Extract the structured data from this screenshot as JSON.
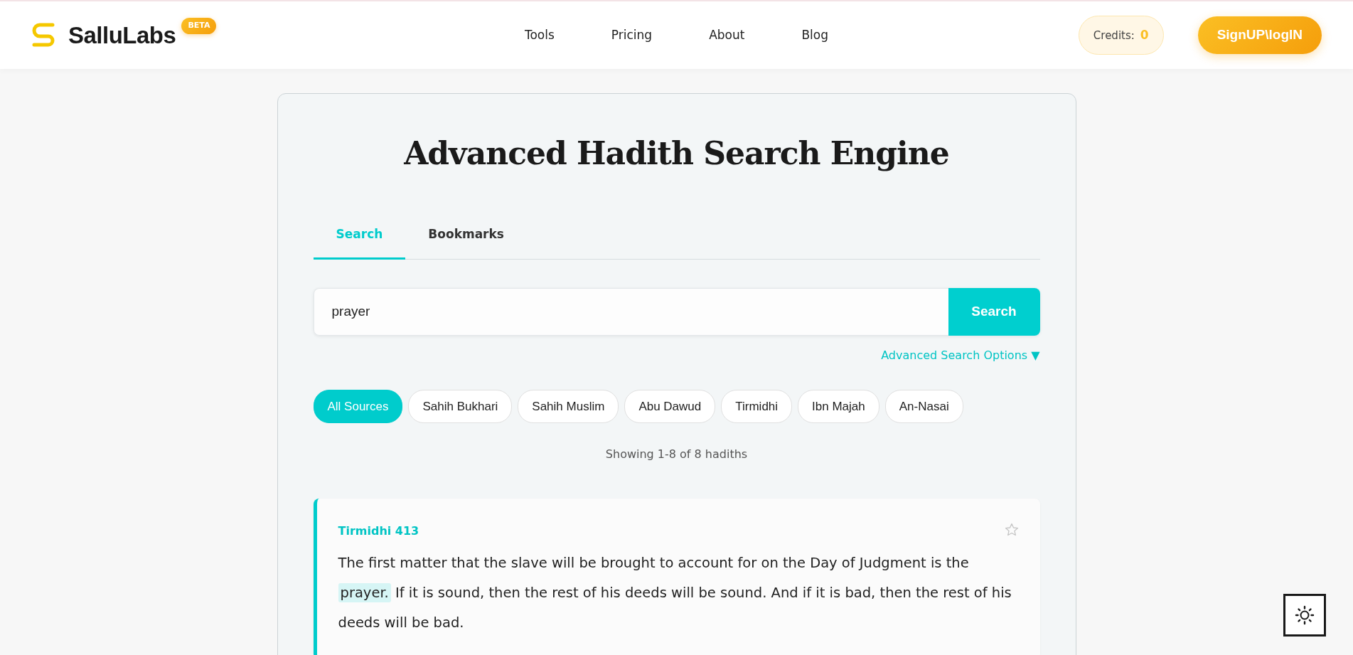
{
  "brand": {
    "name": "SalluLabs",
    "badge": "BETA"
  },
  "nav": [
    {
      "label": "Tools"
    },
    {
      "label": "Pricing"
    },
    {
      "label": "About"
    },
    {
      "label": "Blog"
    }
  ],
  "credits": {
    "label": "Credits:",
    "value": "0"
  },
  "auth_button": "SignUP\\logIN",
  "title": "Advanced Hadith Search Engine",
  "tabs": [
    {
      "label": "Search",
      "selected": true
    },
    {
      "label": "Bookmarks",
      "selected": false
    }
  ],
  "search": {
    "value": "prayer",
    "button": "Search"
  },
  "advanced_link": "Advanced Search Options ▼",
  "sources": [
    {
      "label": "All Sources",
      "selected": true
    },
    {
      "label": "Sahih Bukhari",
      "selected": false
    },
    {
      "label": "Sahih Muslim",
      "selected": false
    },
    {
      "label": "Abu Dawud",
      "selected": false
    },
    {
      "label": "Tirmidhi",
      "selected": false
    },
    {
      "label": "Ibn Majah",
      "selected": false
    },
    {
      "label": "An-Nasai",
      "selected": false
    }
  ],
  "result_count": "Showing 1-8 of 8 hadiths",
  "results": [
    {
      "reference": "Tirmidhi 413",
      "bookmarked": false,
      "text_parts": [
        {
          "text": "The first matter that the slave will be brought to account for on the Day of Judgment is the ",
          "highlighted": false
        },
        {
          "text": "prayer.",
          "highlighted": true
        },
        {
          "text": " If it is sound, then the rest of his deeds will be sound. And if it is bad, then the rest of his deeds will be bad.",
          "highlighted": false
        }
      ]
    }
  ]
}
